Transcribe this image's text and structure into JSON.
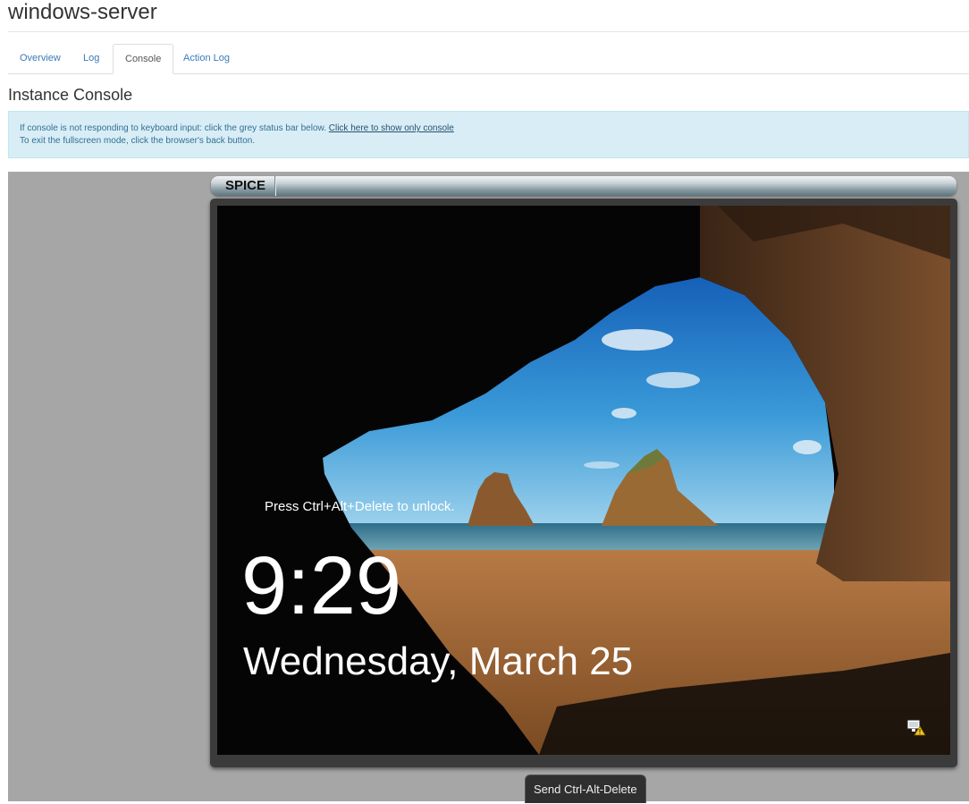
{
  "page": {
    "title": "windows-server"
  },
  "tabs": [
    {
      "label": "Overview"
    },
    {
      "label": "Log"
    },
    {
      "label": "Console",
      "active": true
    },
    {
      "label": "Action Log"
    }
  ],
  "console": {
    "heading": "Instance Console",
    "info_line1": "If console is not responding to keyboard input: click the grey status bar below.",
    "info_link": "Click here to show only console",
    "info_line2": "To exit the fullscreen mode, click the browser's back button.",
    "viewer_label": "SPICE",
    "send_cad_label": "Send Ctrl-Alt-Delete"
  },
  "remote_screen": {
    "unlock_message": "Press Ctrl+Alt+Delete to unlock.",
    "time": "9:29",
    "date": "Wednesday, March 25",
    "status_icon": "network-warning-icon"
  },
  "colors": {
    "link": "#3a7ab8",
    "alert_bg": "#d9edf7",
    "console_bg": "#a6a6a6"
  }
}
